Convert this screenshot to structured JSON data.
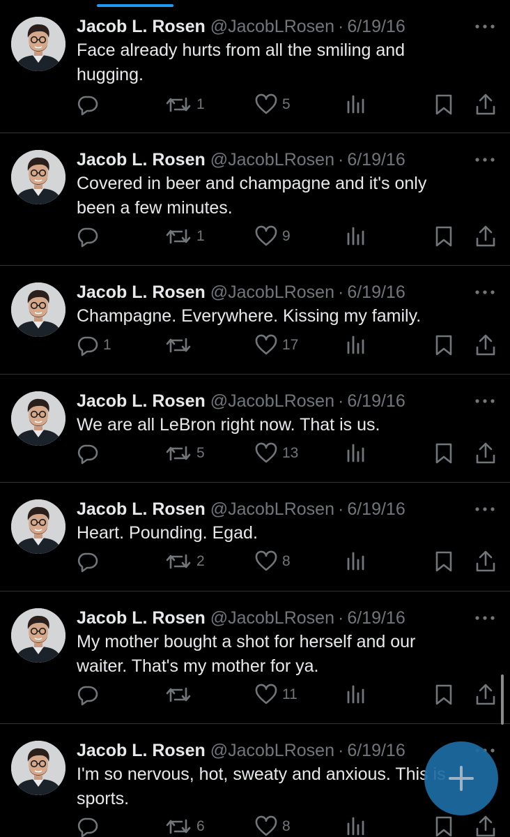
{
  "colors": {
    "background": "#000000",
    "text": "#e7e9ea",
    "secondary": "#71767b",
    "accent": "#1d9bf0",
    "fab": "#1d6ca4",
    "divider": "#2f3336"
  },
  "tweets": [
    {
      "name": "Jacob L. Rosen",
      "handle": "@JacobLRosen",
      "dot": "·",
      "date": "6/19/16",
      "text": "Face already hurts from all the smiling and\nhugging.",
      "replies": "",
      "retweets": "1",
      "likes": "5"
    },
    {
      "name": "Jacob L. Rosen",
      "handle": "@JacobLRosen",
      "dot": "·",
      "date": "6/19/16",
      "text": "Covered in beer and champagne and it's only\nbeen a few minutes.",
      "replies": "",
      "retweets": "1",
      "likes": "9"
    },
    {
      "name": "Jacob L. Rosen",
      "handle": "@JacobLRosen",
      "dot": "·",
      "date": "6/19/16",
      "text": "Champagne. Everywhere. Kissing my family.",
      "replies": "1",
      "retweets": "",
      "likes": "17"
    },
    {
      "name": "Jacob L. Rosen",
      "handle": "@JacobLRosen",
      "dot": "·",
      "date": "6/19/16",
      "text": "We are all LeBron right now. That is us.",
      "replies": "",
      "retweets": "5",
      "likes": "13"
    },
    {
      "name": "Jacob L. Rosen",
      "handle": "@JacobLRosen",
      "dot": "·",
      "date": "6/19/16",
      "text": "Heart. Pounding. Egad.",
      "replies": "",
      "retweets": "2",
      "likes": "8"
    },
    {
      "name": "Jacob L. Rosen",
      "handle": "@JacobLRosen",
      "dot": "·",
      "date": "6/19/16",
      "text": "My mother bought a shot for herself and our\nwaiter. That's my mother for ya.",
      "replies": "",
      "retweets": "",
      "likes": "11"
    },
    {
      "name": "Jacob L. Rosen",
      "handle": "@JacobLRosen",
      "dot": "·",
      "date": "6/19/16",
      "text": "I'm so nervous, hot, sweaty and anxious. This is\nsports.",
      "replies": "",
      "retweets": "6",
      "likes": "8"
    }
  ],
  "icons": {
    "reply": "reply-icon",
    "retweet": "retweet-icon",
    "like": "heart-icon",
    "views": "views-icon",
    "bookmark": "bookmark-icon",
    "share": "share-icon",
    "more": "more-icon",
    "compose": "plus-icon"
  }
}
